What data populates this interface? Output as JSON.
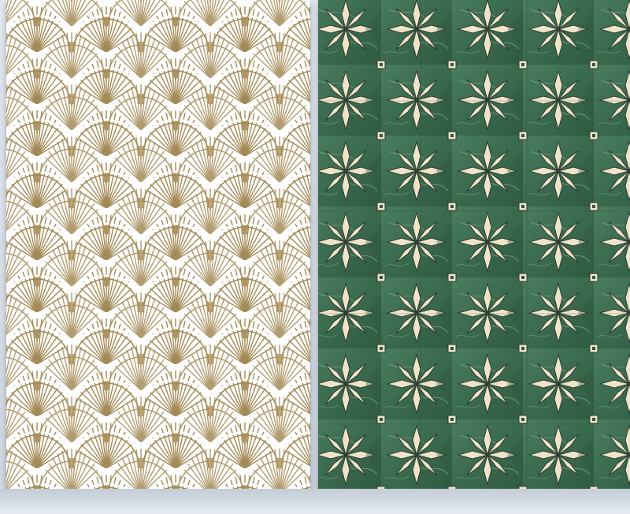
{
  "scene": {
    "left_panel": {
      "pattern": "art-deco-fan-scallop",
      "background_color": "#ffffff",
      "line_color": "#a38a56",
      "accent_color": "#b29660"
    },
    "right_panel": {
      "pattern": "star-and-diamond-marble-tile",
      "marble_color": "#3f6e52",
      "marble_dark": "#2e5640",
      "marble_vein": "#6f9a80",
      "star_color": "#efe4c8",
      "star_outline": "#2b3b32"
    }
  },
  "caption": ""
}
